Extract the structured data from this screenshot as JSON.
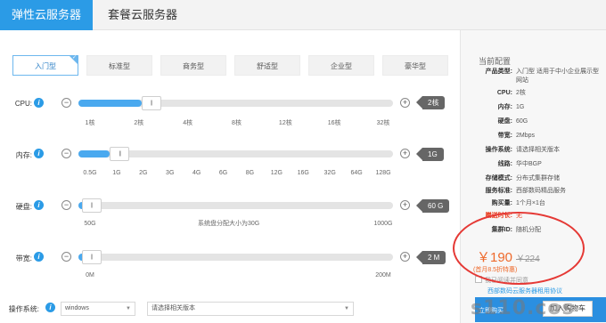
{
  "tabs": [
    {
      "label": "弹性云服务器",
      "active": true
    },
    {
      "label": "套餐云服务器",
      "active": false
    }
  ],
  "packages": [
    {
      "label": "入门型",
      "active": true
    },
    {
      "label": "标准型"
    },
    {
      "label": "商务型"
    },
    {
      "label": "舒适型"
    },
    {
      "label": "企业型"
    },
    {
      "label": "豪华型"
    }
  ],
  "package_check": "✓",
  "info_icon": "i",
  "minus": "−",
  "plus": "+",
  "handle_grip": "|||",
  "sliders": {
    "cpu": {
      "label": "CPU:",
      "value": "2核",
      "ticks": [
        "1核",
        "2核",
        "4核",
        "8核",
        "12核",
        "16核",
        "32核"
      ],
      "level": 0.2
    },
    "memory": {
      "label": "内存:",
      "value": "1G",
      "ticks": [
        "0.5G",
        "1G",
        "2G",
        "3G",
        "4G",
        "6G",
        "8G",
        "12G",
        "16G",
        "32G",
        "64G",
        "128G"
      ],
      "level": 0.1
    },
    "disk": {
      "label": "硬盘:",
      "value": "60 G",
      "ticks": [
        "50G",
        "1000G"
      ],
      "tip": "系统盘分配大小为30G",
      "level": 0.01
    },
    "bandwidth": {
      "label": "带宽:",
      "value": "2 M",
      "ticks": [
        "0M",
        "200M"
      ],
      "level": 0.01
    }
  },
  "os": {
    "label": "操作系统:",
    "system": "windows",
    "version_placeholder": "请选择相关版本",
    "caret": "▼"
  },
  "config": {
    "title": "当前配置",
    "rows": [
      {
        "key": "产品类型:",
        "val": "入门型 适用于中小企业展示型网站"
      },
      {
        "key": "CPU:",
        "val": "2核"
      },
      {
        "key": "内存:",
        "val": "1G"
      },
      {
        "key": "硬盘:",
        "val": "60G"
      },
      {
        "key": "带宽:",
        "val": "2Mbps"
      },
      {
        "key": "操作系统:",
        "val": "请选择相关版本"
      },
      {
        "key": "线路:",
        "val": "华中BGP"
      },
      {
        "key": "存储模式:",
        "val": "分布式集群存储"
      },
      {
        "key": "服务标准:",
        "val": "西部数码精品服务"
      },
      {
        "key": "购买量:",
        "val": "1个月×1台"
      },
      {
        "key": "赠送时长:",
        "val": "无"
      },
      {
        "key": "集群ID:",
        "val": "随机分配"
      }
    ],
    "price": "￥190",
    "old_price": "￥224",
    "discount": "(首月8.5折特惠)",
    "agree_text": "我已阅读并同意",
    "agree_link": "西部数码云服务器租用协议",
    "buy_label": "立即购买",
    "buy_button": "加入购物车"
  },
  "watermark": "s110.cos",
  "colors": {
    "accent": "#2b9be6",
    "price": "#ee6a2c",
    "highlight_ring": "#e53935"
  }
}
